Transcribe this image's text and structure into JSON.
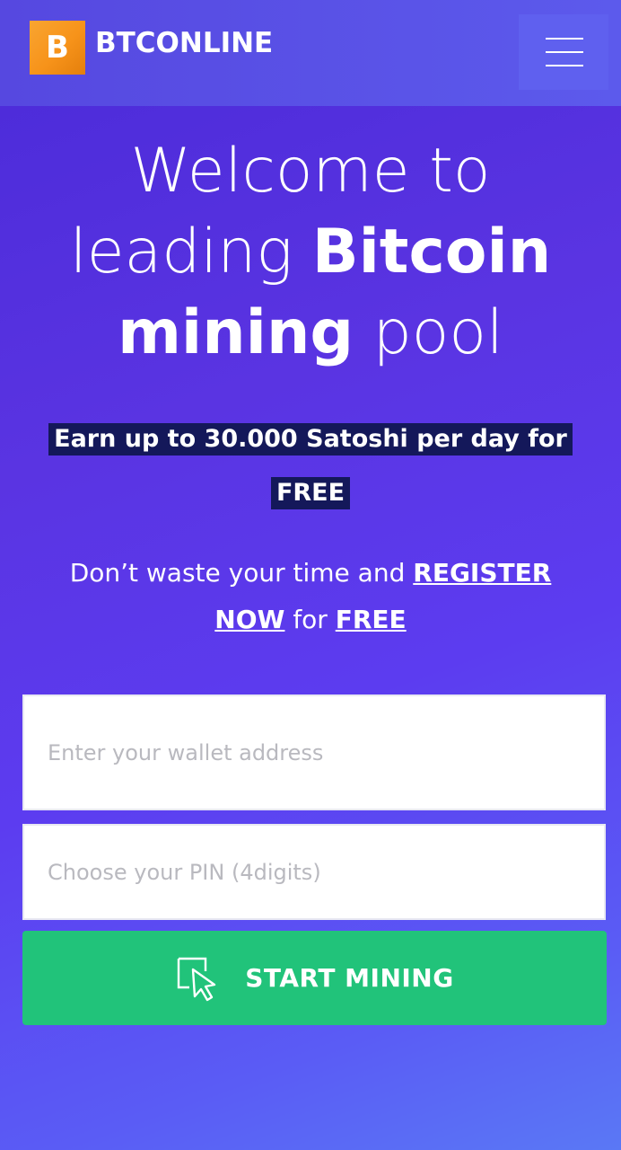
{
  "header": {
    "logo_glyph": "B",
    "brand": "BTCONLINE",
    "menu_icon": "hamburger-menu-icon"
  },
  "hero": {
    "title_line1": "Welcome to",
    "title_line2_light": "leading ",
    "title_line2_bold": "Bitcoin",
    "title_line3_bold": "mining",
    "title_line3_light": " pool",
    "earn_text": "Earn up to 30.000 Satoshi per day for",
    "earn_free": "FREE"
  },
  "register": {
    "prefix": "Don’t waste your time and ",
    "register_link": "REGISTER",
    "now_link": "NOW",
    "middle": " for ",
    "free_link": "FREE"
  },
  "form": {
    "wallet_placeholder": "Enter your wallet address",
    "pin_placeholder": "Choose your PIN (4digits)",
    "submit_label": "START MINING",
    "submit_icon": "cursor-click-icon"
  },
  "colors": {
    "accent_orange": "#f7931a",
    "button_green": "#21c37a",
    "highlight_navy": "#14185a"
  }
}
